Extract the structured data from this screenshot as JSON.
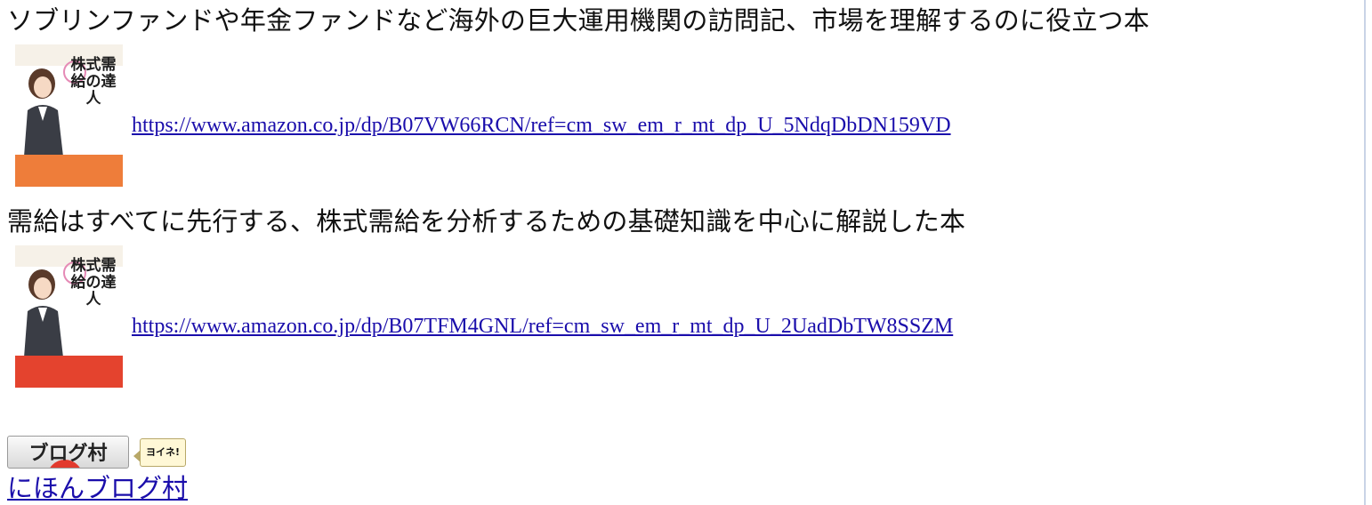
{
  "sections": [
    {
      "heading": "ソブリンファンドや年金ファンドなど海外の巨大運用機関の訪問記、市場を理解するのに役立つ本",
      "link": "https://www.amazon.co.jp/dp/B07VW66RCN/ref=cm_sw_em_r_mt_dp_U_5NdqDbDN159VD",
      "cover_title": "株式需給の達人",
      "cover_band_color": "#ee7d3a"
    },
    {
      "heading": "需給はすべてに先行する、株式需給を分析するための基礎知識を中心に解説した本",
      "link": "https://www.amazon.co.jp/dp/B07TFM4GNL/ref=cm_sw_em_r_mt_dp_U_2UadDbTW8SSZM",
      "cover_title": "株式需給の達人",
      "cover_band_color": "#e4432e"
    }
  ],
  "blog_badge": {
    "button_label": "ブログ村",
    "yoine_label": "ヨイネ!"
  },
  "footer_link": "にほんブログ村"
}
